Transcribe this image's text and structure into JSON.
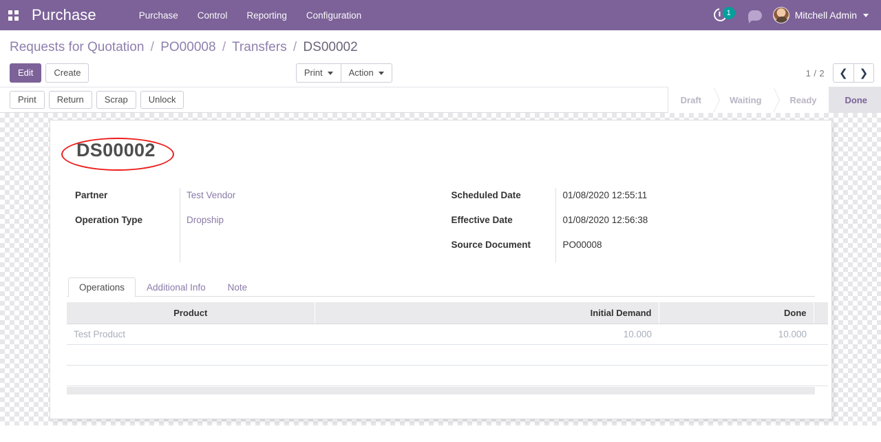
{
  "navbar": {
    "apps_icon": "apps-grid-icon",
    "brand": "Purchase",
    "menu": [
      {
        "label": "Purchase"
      },
      {
        "label": "Control"
      },
      {
        "label": "Reporting"
      },
      {
        "label": "Configuration"
      }
    ],
    "activity_icon": "clock-activity-icon",
    "activity_count": "1",
    "messages_icon": "chat-bubble-icon",
    "user_name": "Mitchell Admin",
    "brand_color": "#7c6298",
    "badge_color": "#00a09d"
  },
  "breadcrumb": {
    "items": [
      {
        "label": "Requests for Quotation",
        "active": false
      },
      {
        "label": "PO00008",
        "active": false
      },
      {
        "label": "Transfers",
        "active": false
      },
      {
        "label": "DS00002",
        "active": true
      }
    ],
    "separator": "/"
  },
  "control_panel": {
    "edit_label": "Edit",
    "create_label": "Create",
    "print_label": "Print",
    "action_label": "Action",
    "pager_text": "1 / 2",
    "prev_icon": "chevron-left-icon",
    "next_icon": "chevron-right-icon"
  },
  "statusbar": {
    "buttons": [
      {
        "label": "Print"
      },
      {
        "label": "Return"
      },
      {
        "label": "Scrap"
      },
      {
        "label": "Unlock"
      }
    ],
    "stages": [
      {
        "label": "Draft",
        "active": false
      },
      {
        "label": "Waiting",
        "active": false
      },
      {
        "label": "Ready",
        "active": false
      },
      {
        "label": "Done",
        "active": true
      }
    ],
    "active_color": "#7c6298"
  },
  "record": {
    "title": "DS00002",
    "annotation": {
      "shape": "red-ellipse",
      "color": "#ee1b1b"
    },
    "fields_left": [
      {
        "label": "Partner",
        "value": "Test Vendor",
        "is_link": true
      },
      {
        "label": "Operation Type",
        "value": "Dropship",
        "is_link": true
      }
    ],
    "fields_right": [
      {
        "label": "Scheduled Date",
        "value": "01/08/2020 12:55:11",
        "is_link": false
      },
      {
        "label": "Effective Date",
        "value": "01/08/2020 12:56:38",
        "is_link": false
      },
      {
        "label": "Source Document",
        "value": "PO00008",
        "is_link": false
      }
    ]
  },
  "notebook": {
    "tabs": [
      {
        "label": "Operations",
        "active": true
      },
      {
        "label": "Additional Info",
        "active": false
      },
      {
        "label": "Note",
        "active": false
      }
    ]
  },
  "operations_table": {
    "columns": [
      {
        "label": "Product",
        "align": "left"
      },
      {
        "label": "Initial Demand",
        "align": "right"
      },
      {
        "label": "Done",
        "align": "right"
      }
    ],
    "rows": [
      {
        "product": "Test Product",
        "initial_demand": "10.000",
        "done": "10.000"
      }
    ],
    "empty_rows": 2
  }
}
